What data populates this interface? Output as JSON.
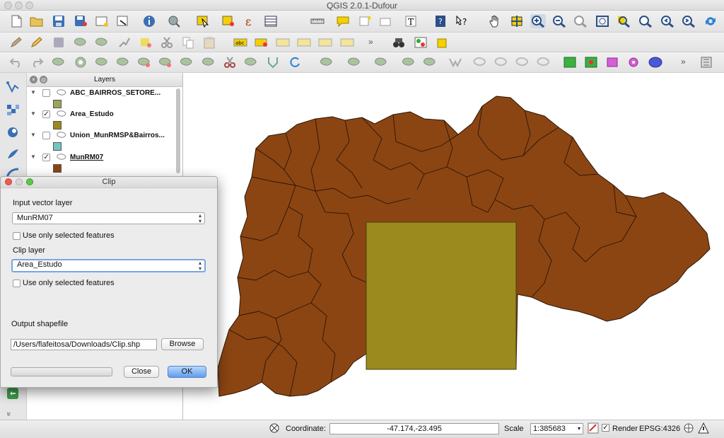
{
  "window": {
    "title": "QGIS 2.0.1-Dufour"
  },
  "toolbars": {
    "row1_icons": [
      "new-project-icon",
      "open-project-icon",
      "save-project-icon",
      "save-as-icon",
      "new-print-composer-icon",
      "composer-manager-icon",
      "identify-icon",
      "pan-to-selection-icon",
      "select-features-icon",
      "deselect-icon",
      "field-calculator-icon",
      "attribute-table-icon",
      "measure-icon",
      "map-tips-icon",
      "new-bookmark-icon",
      "text-annotation-icon",
      "help-icon",
      "whats-this-icon",
      "pan-icon",
      "pan-map-to-selection-icon",
      "zoom-in-icon",
      "zoom-out-icon",
      "zoom-actual-size-icon",
      "zoom-full-icon",
      "zoom-to-selection-icon",
      "zoom-to-layer-icon",
      "zoom-last-icon",
      "zoom-next-icon",
      "refresh-icon"
    ],
    "row2_icons": [
      "toggle-editing-icon",
      "current-edits-icon",
      "save-edits-icon",
      "add-feature-icon",
      "move-feature-icon",
      "node-tool-icon",
      "delete-selected-icon",
      "cut-features-icon",
      "copy-features-icon",
      "paste-features-icon",
      "label-icon",
      "pin-labels-icon",
      "show-hide-labels-icon",
      "move-label-icon",
      "rotate-label-icon",
      "change-label-icon",
      "search-binoculars-icon",
      "georeferencer-icon",
      "new-note-icon"
    ],
    "row3_icons": [
      "undo-icon",
      "redo-icon",
      "simplify-icon",
      "add-ring-icon",
      "add-part-icon",
      "fill-ring-icon",
      "delete-ring-icon",
      "delete-part-icon",
      "reshape-icon",
      "offset-curve-icon",
      "split-features-icon",
      "split-parts-icon",
      "merge-features-icon",
      "merge-attributes-icon",
      "rotate-point-symbols-icon",
      "rotate-feature-icon",
      "circular-string-icon",
      "trace-icon",
      "add-circle-icon",
      "add-ellipse-icon",
      "add-rectangle-icon",
      "add-regular-polygon-icon",
      "add-polygon-icon",
      "add-point-icon",
      "add-oval-icon",
      "plugin-manager-icon"
    ],
    "more_label": "»"
  },
  "left_dock_icons": [
    "add-vector-layer-icon",
    "add-raster-layer-icon",
    "add-postgis-layer-icon",
    "add-spatialite-layer-icon",
    "add-wms-layer-icon",
    "python-console-icon"
  ],
  "layers_panel": {
    "title": "Layers",
    "items": [
      {
        "name": "ABC_BAIRROS_SETORE...",
        "checked": false,
        "swatch": "#a0a45a"
      },
      {
        "name": "Area_Estudo",
        "checked": true,
        "swatch": "#9c8a1c"
      },
      {
        "name": "Union_MunRMSP&Bairros...",
        "checked": false,
        "swatch": "#76c6c0"
      },
      {
        "name": "MunRM07",
        "checked": true,
        "swatch": "#8b4513"
      }
    ]
  },
  "clip_dialog": {
    "title": "Clip",
    "input_label": "Input vector layer",
    "input_value": "MunRM07",
    "input_selected_label": "Use only selected features",
    "clip_label": "Clip layer",
    "clip_value": "Area_Estudo",
    "clip_selected_label": "Use only selected features",
    "output_label": "Output shapefile",
    "output_path": "/Users/flafeitosa/Downloads/Clip.shp",
    "browse_label": "Browse",
    "close_label": "Close",
    "ok_label": "OK"
  },
  "status_bar": {
    "coordinate_label": "Coordinate:",
    "coordinate_value": "-47.174,-23.495",
    "scale_label": "Scale",
    "scale_value": "1:385683",
    "render_label": "Render",
    "render_checked": true,
    "crs_label": "EPSG:4326"
  },
  "map": {
    "municipalities_color": "#8b4513",
    "clip_area_color": "#9b8a1d"
  }
}
